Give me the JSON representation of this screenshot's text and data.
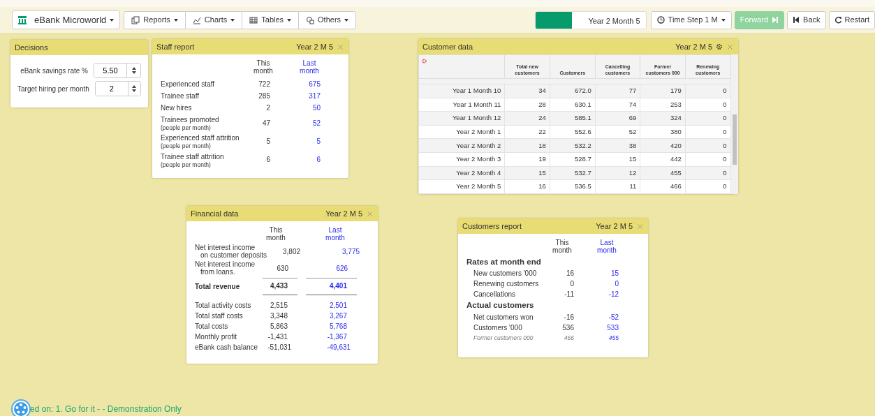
{
  "toolbar": {
    "app_menu": {
      "label": "eBank Microworld"
    },
    "menus": [
      {
        "kind": "reports",
        "label": "Reports"
      },
      {
        "kind": "charts",
        "label": "Charts"
      },
      {
        "kind": "tables",
        "label": "Tables"
      },
      {
        "kind": "others",
        "label": "Others"
      }
    ],
    "progress": {
      "level": 0.33,
      "label": "Year 2 Month 5"
    },
    "time_step": {
      "label": "Time Step 1 M"
    },
    "buttons": [
      {
        "kind": "forward",
        "label": "Forward"
      },
      {
        "kind": "back",
        "label": "Back"
      },
      {
        "kind": "restart",
        "label": "Restart"
      }
    ]
  },
  "decisions": {
    "title": "Decisions",
    "fields": [
      {
        "label": "eBank savings rate %",
        "value": "5.50"
      },
      {
        "label": "Target hiring per month",
        "value": "2"
      }
    ]
  },
  "staff_report": {
    "title": "Staff report",
    "period": "Year 2 M 5",
    "columns": [
      "This month",
      "Last month"
    ],
    "rows": [
      {
        "label": "Experienced staff",
        "this": "722",
        "last": "675"
      },
      {
        "label": "Trainee staff",
        "this": "285",
        "last": "317"
      },
      {
        "label": "New hires",
        "this": "2",
        "last": "50"
      },
      {
        "label": "Trainees promoted",
        "note": "(people per month)",
        "this": "47",
        "last": "52"
      },
      {
        "label": "Experienced staff attrition",
        "note": "(people per month)",
        "this": "5",
        "last": "5"
      },
      {
        "label": "Trainee staff attrition",
        "note": "(people per month)",
        "this": "6",
        "last": "6"
      }
    ]
  },
  "customer_data": {
    "title": "Customer data",
    "period": "Year 2 M 5",
    "columns": [
      "Total new customers",
      "Customers",
      "Cancelling customers",
      "Former customers 000",
      "Renewing customers"
    ],
    "rows": [
      {
        "period": "Year 1 Month 10",
        "values": [
          "34",
          "672.0",
          "77",
          "179",
          "0"
        ]
      },
      {
        "period": "Year 1 Month 11",
        "values": [
          "28",
          "630.1",
          "74",
          "253",
          "0"
        ]
      },
      {
        "period": "Year 1 Month 12",
        "values": [
          "24",
          "585.1",
          "69",
          "324",
          "0"
        ]
      },
      {
        "period": "Year 2 Month 1",
        "values": [
          "22",
          "552.6",
          "52",
          "380",
          "0"
        ]
      },
      {
        "period": "Year 2 Month 2",
        "values": [
          "18",
          "532.2",
          "38",
          "420",
          "0"
        ]
      },
      {
        "period": "Year 2 Month 3",
        "values": [
          "19",
          "528.7",
          "15",
          "442",
          "0"
        ]
      },
      {
        "period": "Year 2 Month 4",
        "values": [
          "15",
          "532.7",
          "12",
          "455",
          "0"
        ]
      },
      {
        "period": "Year 2 Month 5",
        "values": [
          "16",
          "536.5",
          "11",
          "466",
          "0"
        ]
      }
    ]
  },
  "financial_data": {
    "title": "Financial data",
    "period": "Year 2 M 5",
    "columns": [
      "This month",
      "Last month"
    ],
    "rows": [
      {
        "kind": "row",
        "label": "Net interest income",
        "label_2": "on customer deposits",
        "this": "3,802",
        "last": "3,775"
      },
      {
        "kind": "row",
        "label": "Net interest income",
        "label_2": "from loans.",
        "this": "630",
        "last": "626"
      },
      {
        "kind": "total",
        "label": "Total revenue",
        "this": "4,433",
        "last": "4,401"
      },
      {
        "kind": "row",
        "label": "Total activity costs",
        "this": "2,515",
        "last": "2,501"
      },
      {
        "kind": "row",
        "label": "Total staff costs",
        "this": "3,348",
        "last": "3,267"
      },
      {
        "kind": "row",
        "label": "Total costs",
        "this": "5,863",
        "last": "5,768"
      },
      {
        "kind": "row",
        "label": "Monthly profit",
        "this": "-1,431",
        "last": "-1,367"
      },
      {
        "kind": "row",
        "label": "eBank cash balance",
        "this": "-51,031",
        "last": "-49,631"
      }
    ]
  },
  "customers_report": {
    "title": "Customers report",
    "period": "Year 2 M 5",
    "columns": [
      "This month",
      "Last month"
    ],
    "rows": [
      {
        "kind": "heading",
        "label": "Rates at month end"
      },
      {
        "kind": "row",
        "label": "New customers '000",
        "this": "16",
        "last": "15"
      },
      {
        "kind": "row",
        "label": "Renewing customers",
        "this": "0",
        "last": "0"
      },
      {
        "kind": "row",
        "label": "Cancellations",
        "this": "-11",
        "last": "-12"
      },
      {
        "kind": "heading",
        "label": "Actual customers"
      },
      {
        "kind": "row",
        "label": "Net customers won",
        "this": "-16",
        "last": "-52"
      },
      {
        "kind": "row",
        "label": "Customers '000",
        "this": "536",
        "last": "533"
      },
      {
        "kind": "note",
        "label": "Former customers 000",
        "this": "466",
        "last": "455"
      }
    ]
  },
  "footer": {
    "text": "ed on: 1. Go for it - - Demonstration Only"
  }
}
